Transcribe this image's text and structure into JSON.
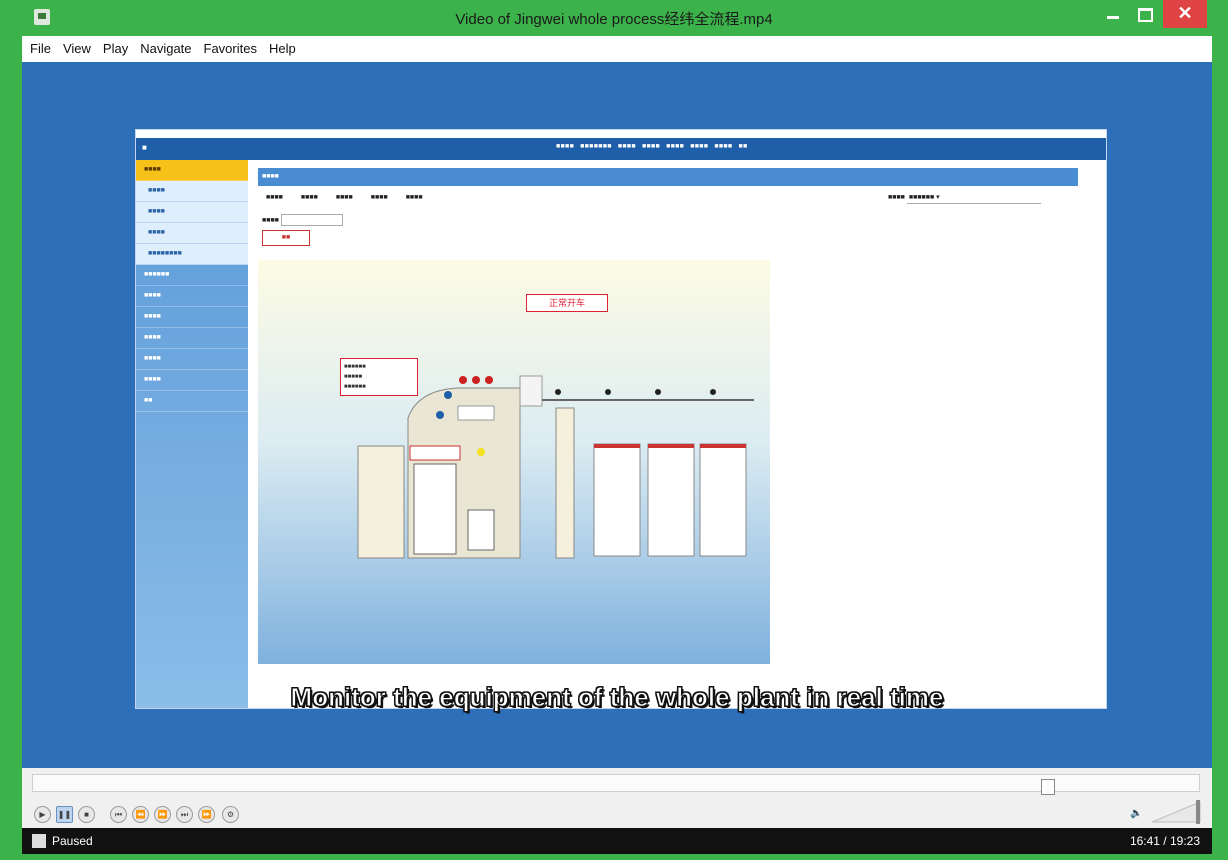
{
  "window": {
    "title": "Video of Jingwei whole process经纬全流程.mp4",
    "close_glyph": "✕"
  },
  "menu": [
    "File",
    "View",
    "Play",
    "Navigate",
    "Favorites",
    "Help"
  ],
  "caption": "Monitor the equipment of the whole plant in real time",
  "embedded_app": {
    "scada_status": "正常开车"
  },
  "player": {
    "status": "Paused",
    "time": "16:41 / 19:23"
  },
  "colors": {
    "window_border": "#3cb24a",
    "video_bg": "#2d6fb8",
    "close_button": "#e04343"
  }
}
